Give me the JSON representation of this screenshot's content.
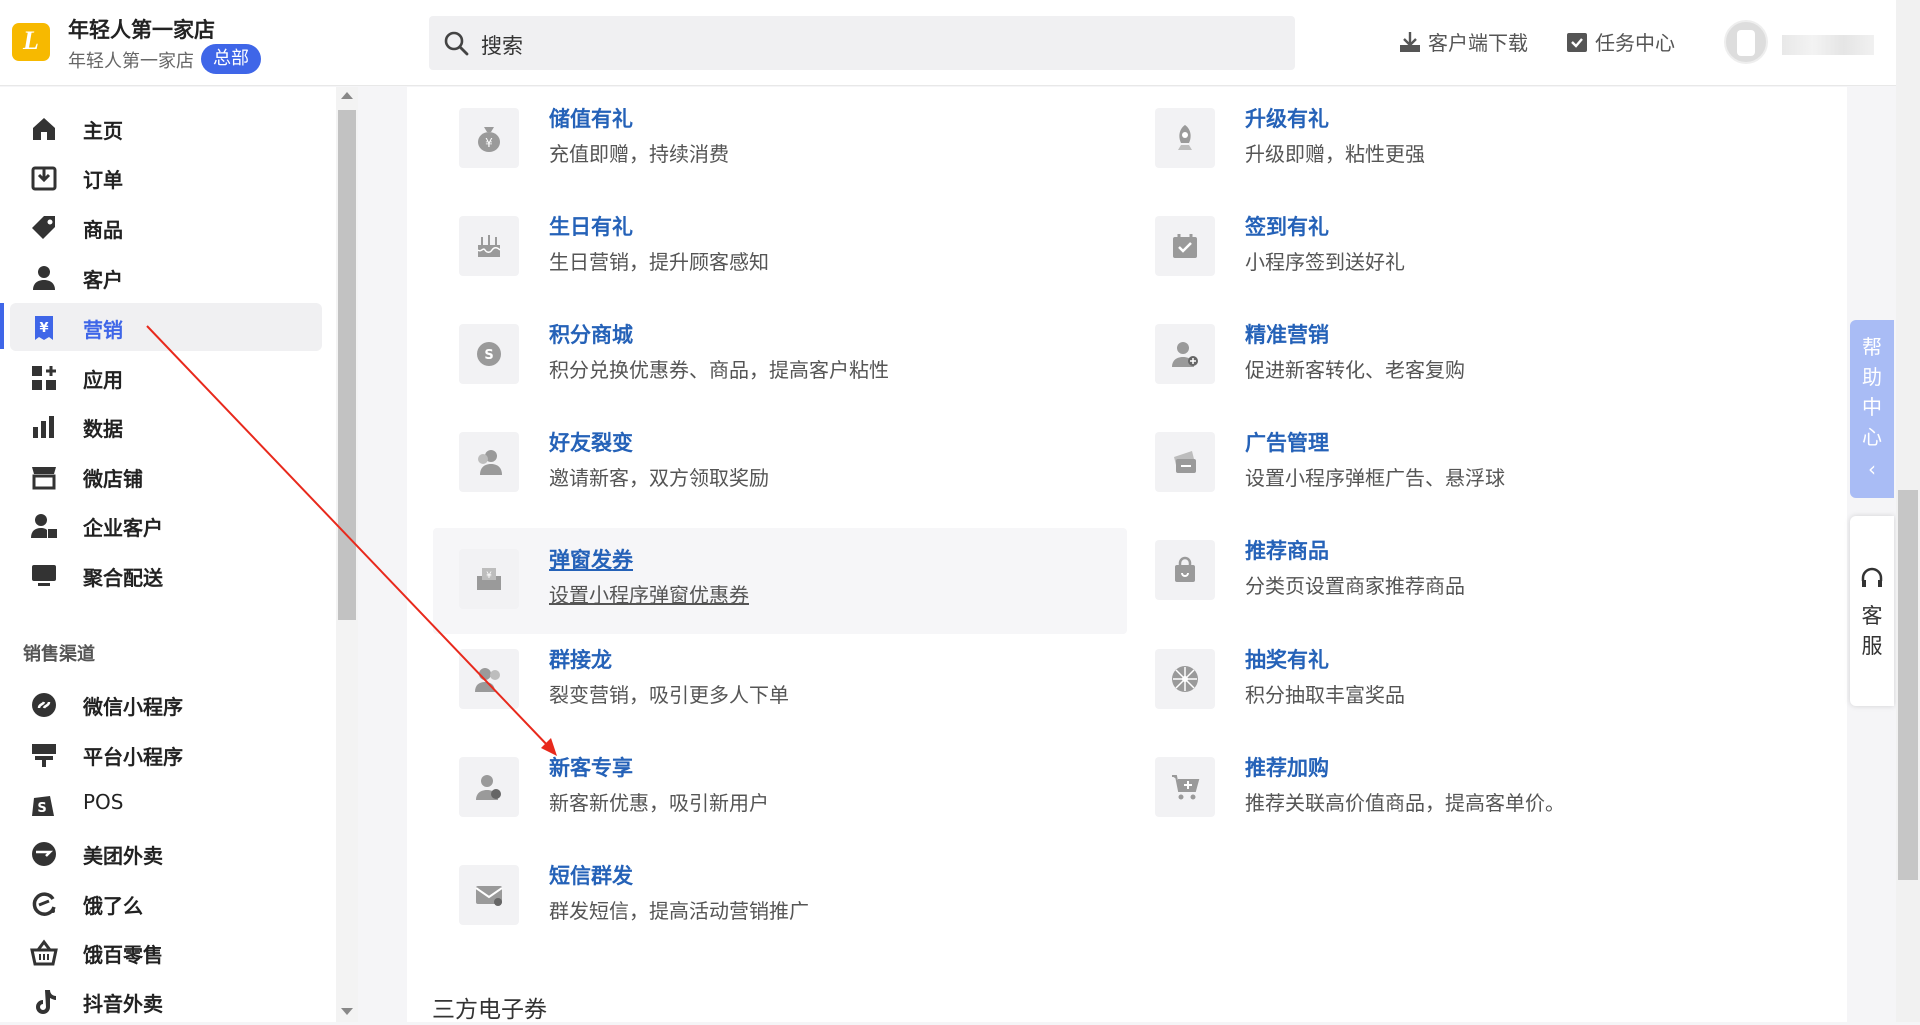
{
  "header": {
    "shop_name": "年轻人第一家店",
    "shop_sub": "年轻人第一家店",
    "hq_badge": "总部",
    "search_placeholder": "搜索",
    "download_label": "客户端下载",
    "tasks_label": "任务中心"
  },
  "sidebar": {
    "items": [
      {
        "label": "主页",
        "icon": "home-icon"
      },
      {
        "label": "订单",
        "icon": "order-icon"
      },
      {
        "label": "商品",
        "icon": "tag-icon"
      },
      {
        "label": "客户",
        "icon": "user-icon"
      },
      {
        "label": "营销",
        "icon": "marketing-icon",
        "active": true
      },
      {
        "label": "应用",
        "icon": "apps-icon"
      },
      {
        "label": "数据",
        "icon": "data-icon"
      },
      {
        "label": "微店铺",
        "icon": "store-icon"
      },
      {
        "label": "企业客户",
        "icon": "enterprise-user-icon"
      },
      {
        "label": "聚合配送",
        "icon": "delivery-icon"
      }
    ],
    "channels_label": "销售渠道",
    "channels": [
      {
        "label": "微信小程序",
        "icon": "wechat-miniprogram-icon"
      },
      {
        "label": "平台小程序",
        "icon": "platform-miniprogram-icon"
      },
      {
        "label": "POS",
        "icon": "pos-icon"
      },
      {
        "label": "美团外卖",
        "icon": "meituan-icon"
      },
      {
        "label": "饿了么",
        "icon": "eleme-icon"
      },
      {
        "label": "饿百零售",
        "icon": "ebai-icon"
      },
      {
        "label": "抖音外卖",
        "icon": "douyin-icon"
      }
    ]
  },
  "marketing": {
    "left": [
      {
        "title": "储值有礼",
        "desc": "充值即赠，持续消费",
        "icon": "money-bag-icon"
      },
      {
        "title": "生日有礼",
        "desc": "生日营销，提升顾客感知",
        "icon": "cake-icon"
      },
      {
        "title": "积分商城",
        "desc": "积分兑换优惠券、商品，提高客户粘性",
        "icon": "points-icon"
      },
      {
        "title": "好友裂变",
        "desc": "邀请新客，双方领取奖励",
        "icon": "friends-icon"
      },
      {
        "title": "弹窗发券",
        "desc": "设置小程序弹窗优惠券",
        "icon": "popup-coupon-icon"
      },
      {
        "title": "群接龙",
        "desc": "裂变营销，吸引更多人下单",
        "icon": "group-icon"
      },
      {
        "title": "新客专享",
        "desc": "新客新优惠，吸引新用户",
        "icon": "new-user-icon"
      },
      {
        "title": "短信群发",
        "desc": "群发短信，提高活动营销推广",
        "icon": "sms-icon"
      }
    ],
    "right": [
      {
        "title": "升级有礼",
        "desc": "升级即赠，粘性更强",
        "icon": "rocket-icon"
      },
      {
        "title": "签到有礼",
        "desc": "小程序签到送好礼",
        "icon": "checkin-icon"
      },
      {
        "title": "精准营销",
        "desc": "促进新客转化、老客复购",
        "icon": "target-user-icon"
      },
      {
        "title": "广告管理",
        "desc": "设置小程序弹框广告、悬浮球",
        "icon": "ad-icon"
      },
      {
        "title": "推荐商品",
        "desc": "分类页设置商家推荐商品",
        "icon": "bag-icon"
      },
      {
        "title": "抽奖有礼",
        "desc": "积分抽取丰富奖品",
        "icon": "wheel-icon"
      },
      {
        "title": "推荐加购",
        "desc": "推荐关联高价值商品，提高客单价。",
        "icon": "cart-icon"
      }
    ],
    "next_section": "三方电子券"
  },
  "floating": {
    "help_label": "帮助中心",
    "service_label": "客服"
  },
  "colors": {
    "accent": "#3f66e8",
    "link": "#2562b8",
    "arrow": "#e8291c"
  }
}
